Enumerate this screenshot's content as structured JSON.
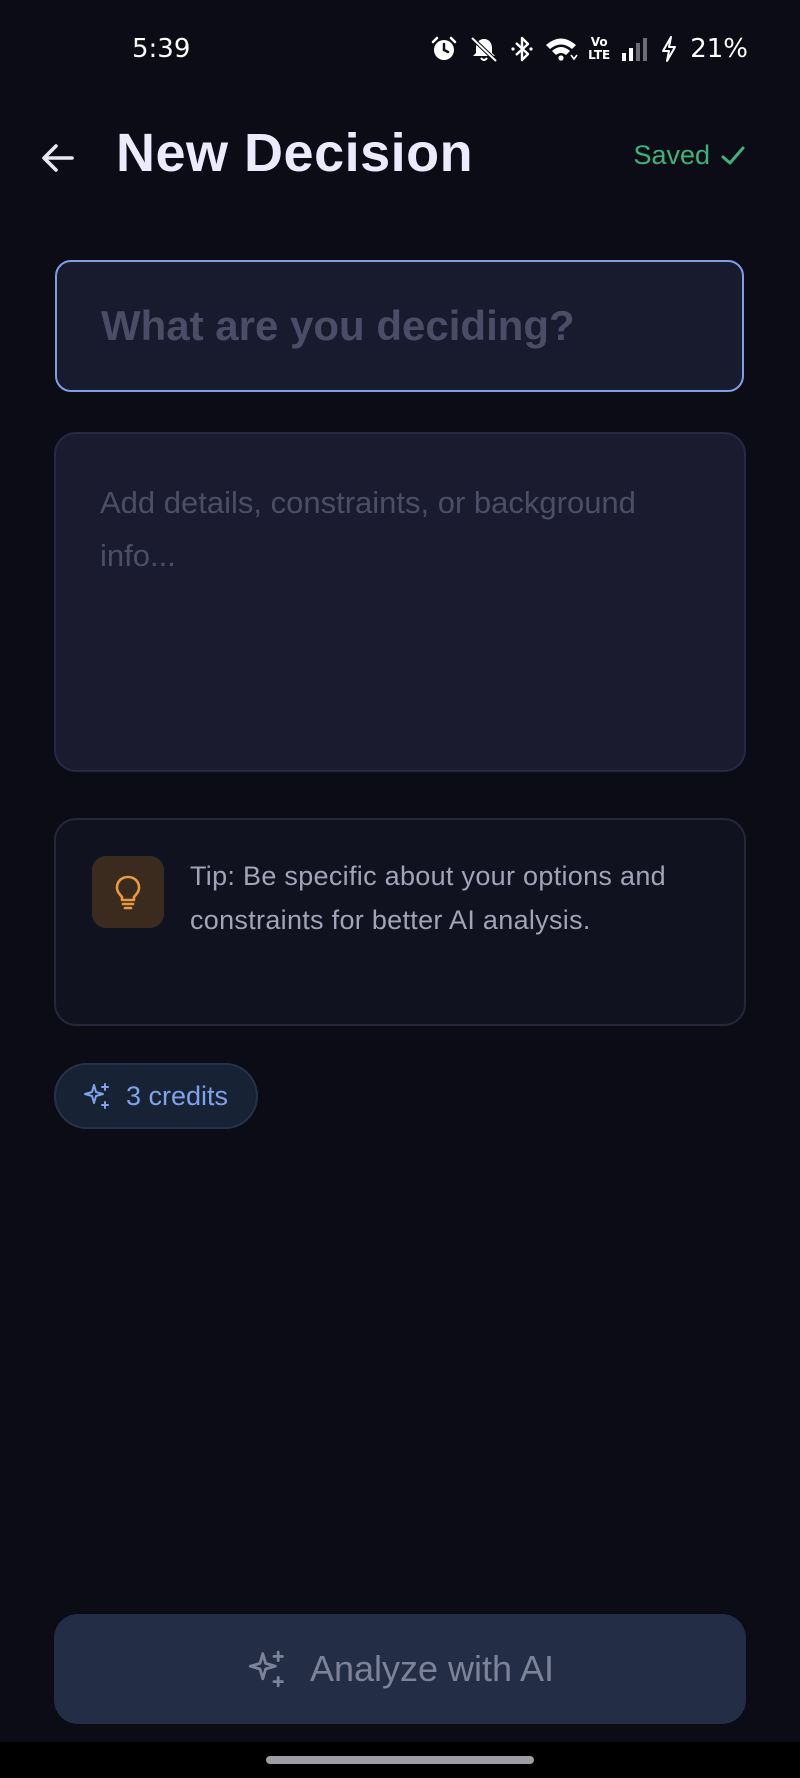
{
  "status_bar": {
    "time": "5:39",
    "battery": "21%",
    "icons": [
      "alarm-icon",
      "mute-icon",
      "bluetooth-icon",
      "wifi-icon",
      "volte-icon",
      "signal-icon",
      "charging-icon"
    ],
    "volte_line1": "Vo",
    "volte_line2": "LTE"
  },
  "header": {
    "back_icon": "arrow-left-icon",
    "title": "New Decision",
    "saved_label": "Saved",
    "saved_icon": "check-icon"
  },
  "form": {
    "title_value": "",
    "title_placeholder": "What are you deciding?",
    "details_value": "",
    "details_placeholder": "Add details, constraints, or background info..."
  },
  "tip": {
    "icon": "lightbulb-icon",
    "text": "Tip: Be specific about your options and constraints for better AI analysis."
  },
  "credits": {
    "icon": "sparkles-icon",
    "label": "3 credits"
  },
  "analyze": {
    "icon": "sparkles-icon",
    "label": "Analyze with AI"
  },
  "colors": {
    "background": "#0c0c16",
    "accent_blue": "#7f9ee6",
    "saved_green": "#3fb27a",
    "tip_icon_orange": "#e89a3c",
    "credits_blue": "#7fa3ea",
    "button_bg": "#232d45"
  }
}
